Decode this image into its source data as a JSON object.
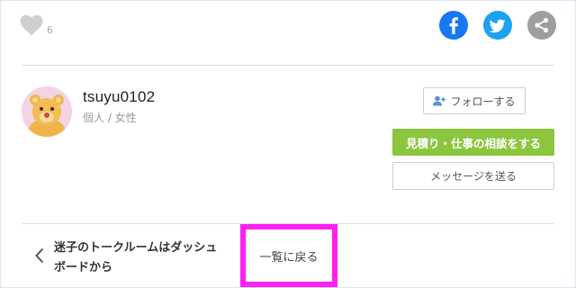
{
  "like": {
    "count": "6",
    "icon": "heart-icon"
  },
  "share": {
    "facebook_color": "#1877f2",
    "twitter_color": "#1da1f2",
    "generic_color": "#9e9e9e"
  },
  "profile": {
    "username": "tsuyu0102",
    "meta": "個人 / 女性"
  },
  "actions": {
    "follow_label": "フォローする",
    "estimate_label": "見積り・仕事の相談をする",
    "message_label": "メッセージを送る",
    "accent_color": "#8cc63f"
  },
  "nav": {
    "back_label": "迷子のトークルームはダッシュボードから",
    "list_label": "一覧に戻る",
    "highlight_color": "#ff1ff2"
  }
}
